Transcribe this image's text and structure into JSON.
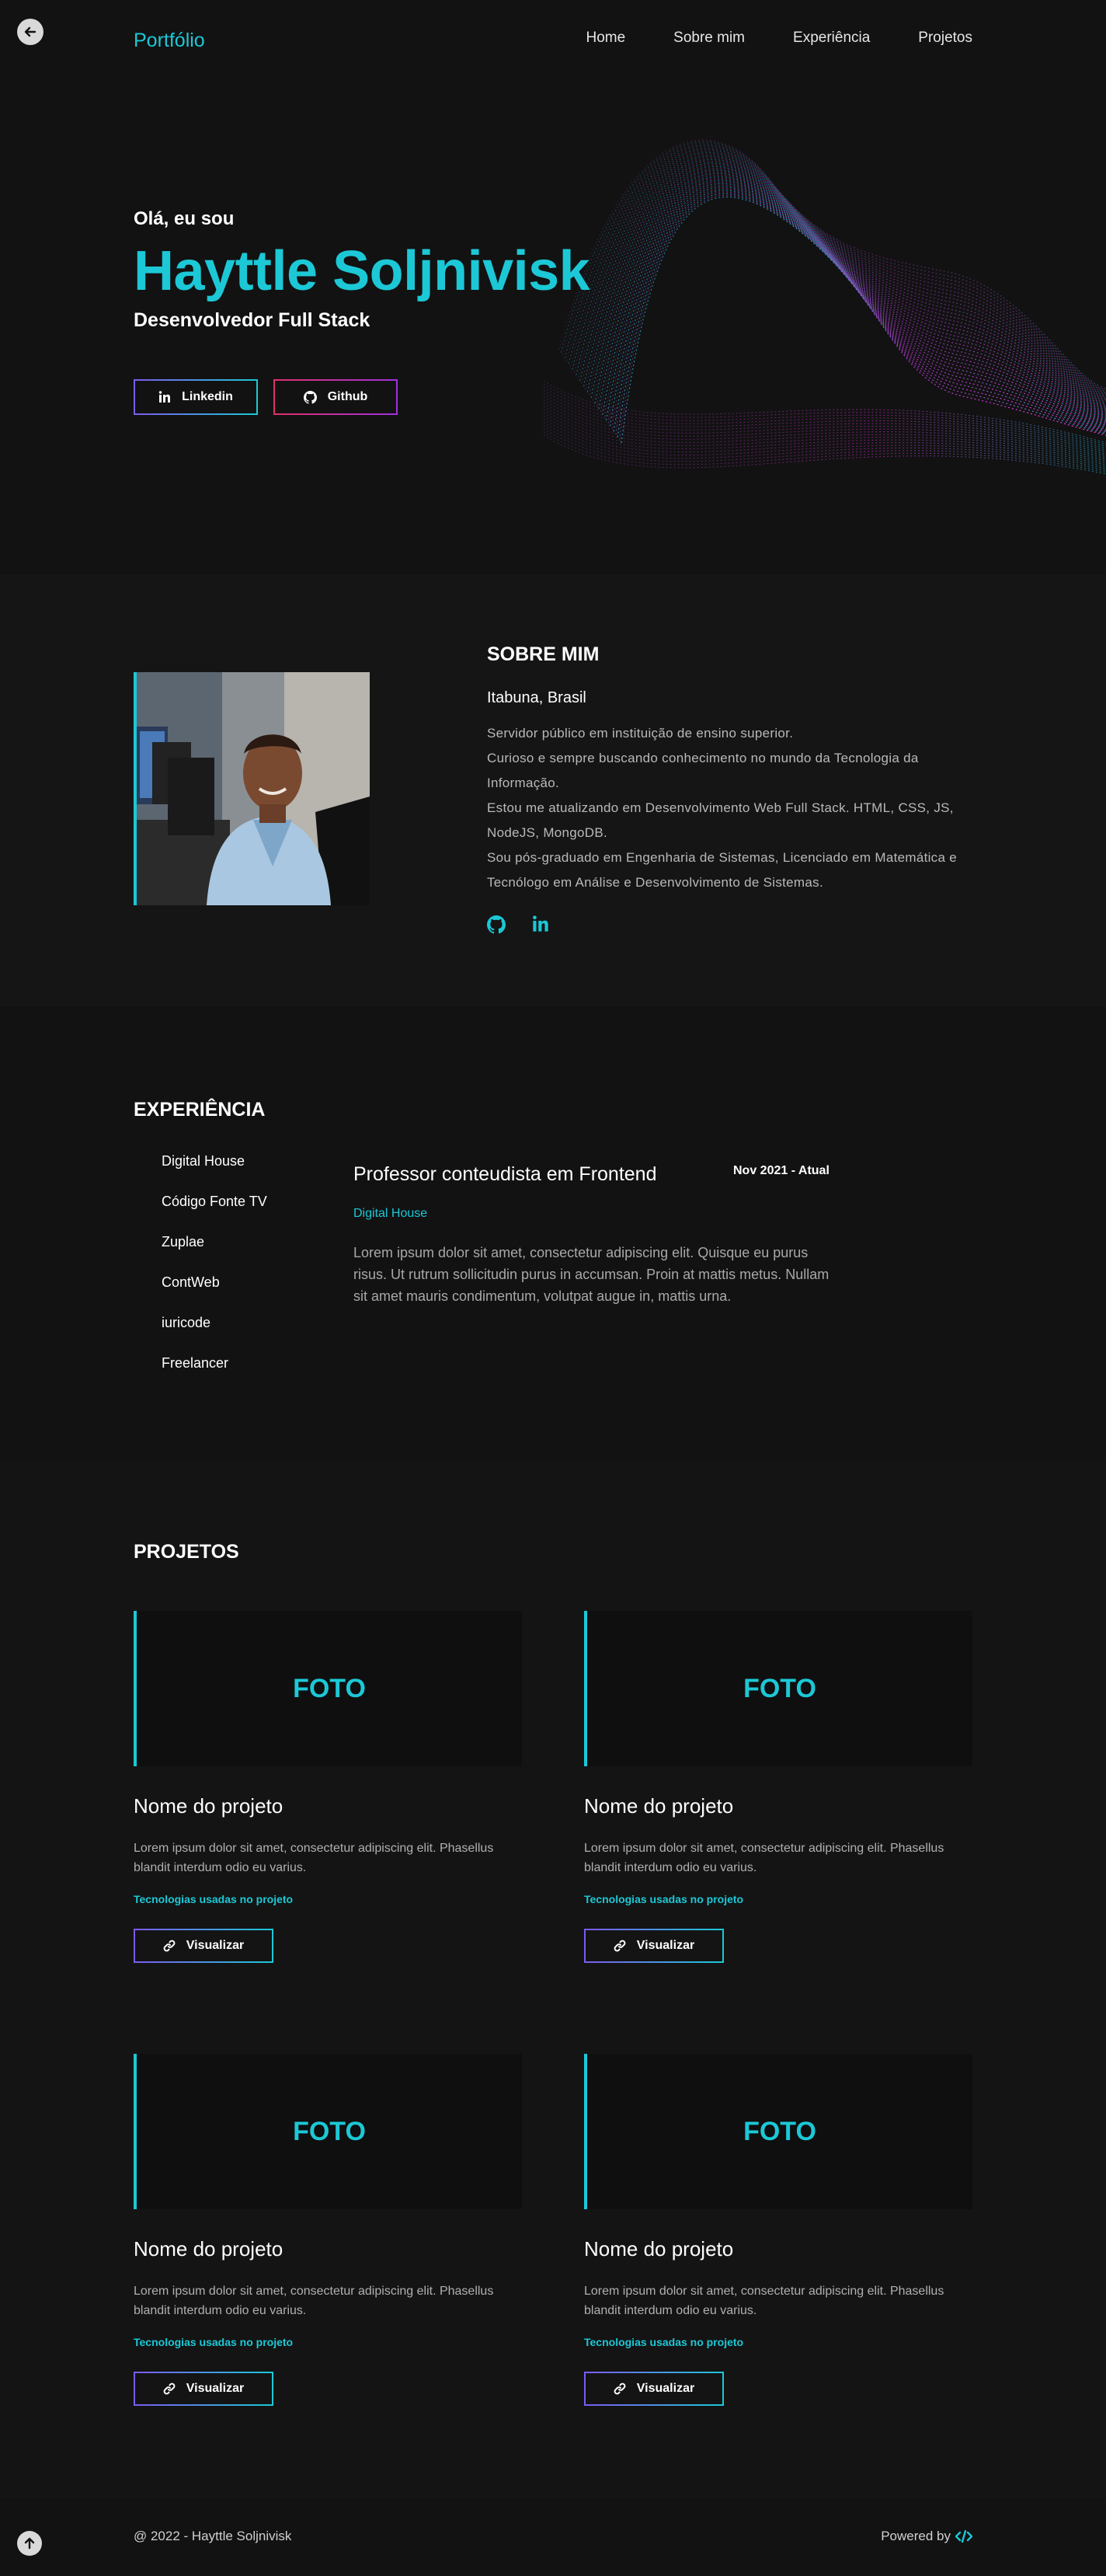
{
  "header": {
    "logo": "Portfólio",
    "nav": [
      "Home",
      "Sobre mim",
      "Experiência",
      "Projetos"
    ]
  },
  "hero": {
    "greeting": "Olá, eu sou",
    "name": "Hayttle Soljnivisk",
    "role": "Desenvolvedor Full Stack",
    "buttons": [
      "Linkedin",
      "Github"
    ]
  },
  "about": {
    "title": "SOBRE MIM",
    "location": "Itabuna, Brasil",
    "lines": [
      "Servidor público em instituição de ensino superior.",
      "Curioso e sempre buscando conhecimento no mundo da Tecnologia da Informação.",
      "Estou me atualizando em Desenvolvimento Web Full Stack. HTML, CSS, JS, NodeJS, MongoDB.",
      "Sou pós-graduado em Engenharia de Sistemas, Licenciado em Matemática e Tecnólogo em Análise e Desenvolvimento de Sistemas."
    ]
  },
  "experience": {
    "title": "EXPERIÊNCIA",
    "companies": [
      "Digital House",
      "Código Fonte TV",
      "Zuplae",
      "ContWeb",
      "iuricode",
      "Freelancer"
    ],
    "job_title": "Professor conteudista em Frontend",
    "date": "Nov 2021 - Atual",
    "company": "Digital House",
    "description": "Lorem ipsum dolor sit amet, consectetur adipiscing elit. Quisque eu purus risus. Ut rutrum sollicitudin purus in accumsan. Proin at mattis metus. Nullam sit amet mauris condimentum, volutpat augue in, mattis urna."
  },
  "projects": {
    "title": "PROJETOS",
    "items": [
      {
        "foto": "FOTO",
        "name": "Nome do projeto",
        "desc": "Lorem ipsum dolor sit amet, consectetur adipiscing elit. Phasellus blandit interdum odio eu varius.",
        "tech": "Tecnologias usadas no projeto",
        "button": "Visualizar"
      },
      {
        "foto": "FOTO",
        "name": "Nome do projeto",
        "desc": "Lorem ipsum dolor sit amet, consectetur adipiscing elit. Phasellus blandit interdum odio eu varius.",
        "tech": "Tecnologias usadas no projeto",
        "button": "Visualizar"
      },
      {
        "foto": "FOTO",
        "name": "Nome do projeto",
        "desc": "Lorem ipsum dolor sit amet, consectetur adipiscing elit. Phasellus blandit interdum odio eu varius.",
        "tech": "Tecnologias usadas no projeto",
        "button": "Visualizar"
      },
      {
        "foto": "FOTO",
        "name": "Nome do projeto",
        "desc": "Lorem ipsum dolor sit amet, consectetur adipiscing elit. Phasellus blandit interdum odio eu varius.",
        "tech": "Tecnologias usadas no projeto",
        "button": "Visualizar"
      }
    ]
  },
  "footer": {
    "copyright": "@ 2022 - Hayttle Soljnivisk",
    "powered": "Powered by"
  },
  "colors": {
    "accent": "#1cc8d6",
    "background": "#121212",
    "magenta": "#e030e0"
  },
  "icons": [
    "arrow-left-icon",
    "linkedin-icon",
    "github-icon",
    "link-icon",
    "code-icon",
    "arrow-up-icon"
  ]
}
